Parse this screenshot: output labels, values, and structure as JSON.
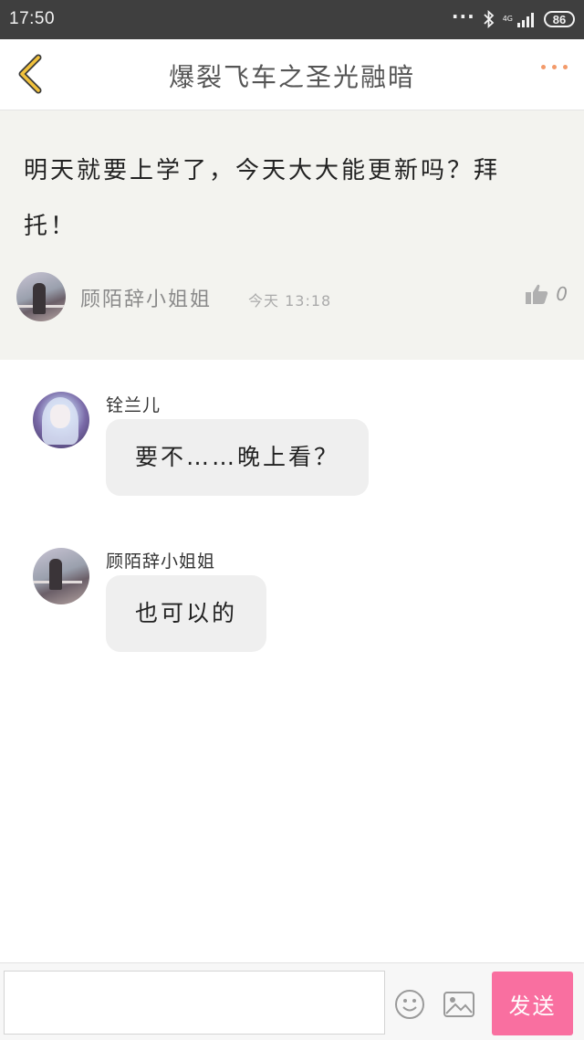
{
  "status_bar": {
    "time": "17:50",
    "network": "4G",
    "battery": "86",
    "icons": [
      "more-dots-icon",
      "bluetooth-icon",
      "signal-icon",
      "battery-icon"
    ]
  },
  "header": {
    "title": "爆裂飞车之圣光融暗",
    "back_icon": "chevron-left-icon",
    "more_icon": "more-dots-icon",
    "back_color": "#f2c23c",
    "more_color": "#f39a6a"
  },
  "post": {
    "text": "明天就要上学了，今天大大能更新吗？拜托！",
    "author": "顾陌辞小姐姐",
    "time": "今天 13:18",
    "like_icon": "thumbs-up-icon",
    "like_count": "0"
  },
  "replies": [
    {
      "name": "铨兰儿",
      "message": "要不……晚上看？"
    },
    {
      "name": "顾陌辞小姐姐",
      "message": "也可以的"
    }
  ],
  "composer": {
    "input_value": "",
    "emoji_icon": "smiley-icon",
    "image_icon": "image-icon",
    "send_label": "发送",
    "send_color": "#f96fa0"
  }
}
